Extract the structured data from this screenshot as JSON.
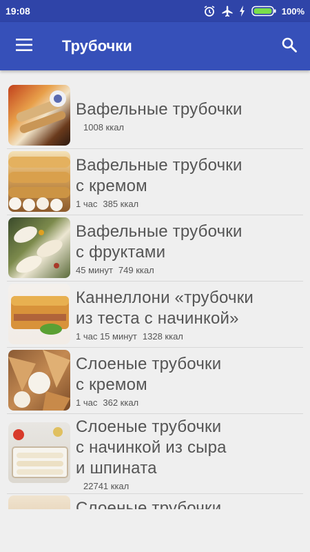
{
  "status_bar": {
    "time": "19:08",
    "battery": "100%"
  },
  "app_bar": {
    "title": "Трубочки"
  },
  "recipes": [
    {
      "title": "Вафельные трубочки",
      "time": "",
      "kcal": "1008 ккал"
    },
    {
      "title": "Вафельные трубочки\nс кремом",
      "time": "1 час",
      "kcal": "385 ккал"
    },
    {
      "title": "Вафельные трубочки\nс фруктами",
      "time": "45 минут",
      "kcal": "749 ккал"
    },
    {
      "title": "Каннеллони «трубочки\nиз теста с начинкой»",
      "time": "1 час 15 минут",
      "kcal": "1328 ккал"
    },
    {
      "title": "Слоеные трубочки\nс кремом",
      "time": "1 час",
      "kcal": "362 ккал"
    },
    {
      "title": "Слоеные трубочки\nс начинкой из сыра\nи шпината",
      "time": "",
      "kcal": "22741 ккал"
    },
    {
      "title": "Слоеные трубочки",
      "time": "",
      "kcal": ""
    }
  ]
}
